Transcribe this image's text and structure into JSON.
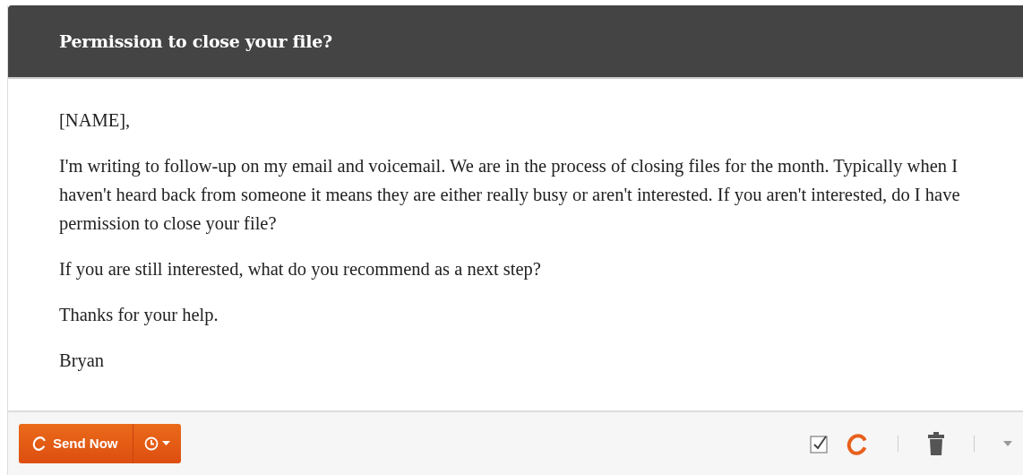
{
  "email": {
    "subject": "Permission to close your file?",
    "paragraphs": [
      "[NAME],",
      "I'm writing to follow-up on my email and voicemail. We are in the process of closing files for the month. Typically when I haven't heard back from someone it means they are either really busy or aren't interested. If you aren't interested, do I have permission to close your file?",
      "If you are still interested, what do you recommend as a next step?",
      "Thanks for your help.",
      "Bryan"
    ]
  },
  "footer": {
    "send_button": "Send Now"
  }
}
